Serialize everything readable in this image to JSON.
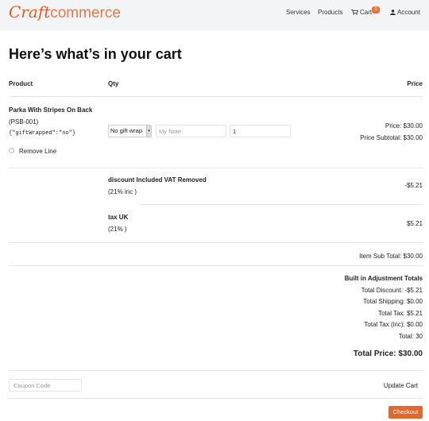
{
  "header": {
    "logo_craft": "Craft",
    "logo_commerce": "commerce",
    "nav": {
      "services": "Services",
      "products": "Products",
      "cart": "Cart",
      "cart_count": "1",
      "account": "Account"
    }
  },
  "page_title": "Here’s what’s in your cart",
  "table_headers": {
    "product": "Product",
    "qty": "Qty",
    "price": "Price"
  },
  "line_item": {
    "name": "Parka With Stripes On Back",
    "sku": "(PSB-001)",
    "options": "{\"giftWrapped\":\"no\"}",
    "gift_wrap_select": "No gift wrap",
    "note_placeholder": "My Note",
    "qty_value": "1",
    "price": "Price: $30.00",
    "subtotal": "Price Subtotal: $30.00",
    "remove_label": "Remove Line"
  },
  "adjustments": [
    {
      "name": "discount Included VAT Removed",
      "detail": "(21% inc )",
      "amount": "-$5.21"
    },
    {
      "name": "tax UK",
      "detail": "(21% )",
      "amount": "$5.21"
    }
  ],
  "item_subtotal": "Item Sub Total: $30.00",
  "adjustment_totals": {
    "heading": "Built in Adjustment Totals",
    "discount": "Total Discount: -$5.21",
    "shipping": "Total Shipping: $0.00",
    "tax": "Total Tax: $5.21",
    "tax_inc": "Total Tax (inc): $0.00",
    "total": "Total: 30"
  },
  "total_price": "Total Price: $30.00",
  "coupon_placeholder": "Coupon Code",
  "update_cart_label": "Update Cart",
  "checkout_label": "Checkout",
  "colors": {
    "accent": "#e0692e",
    "header_bg": "#f3f4f6"
  },
  "icons": {
    "cart": "cart-icon",
    "account": "user-icon"
  }
}
